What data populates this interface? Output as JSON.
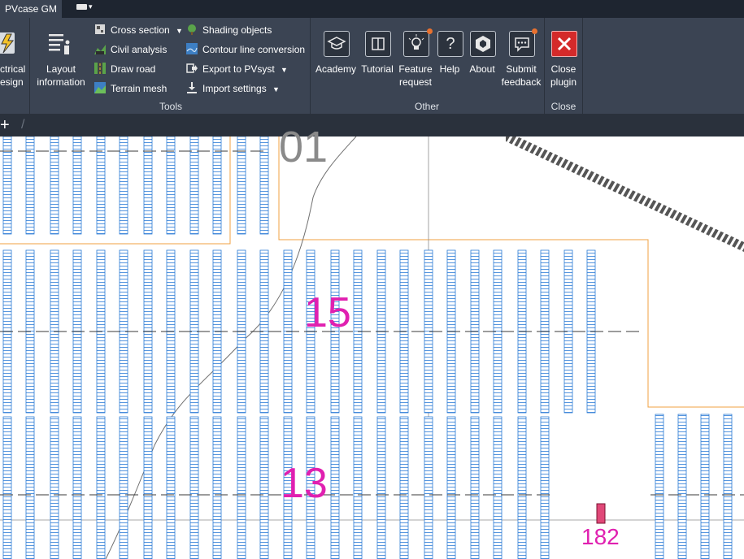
{
  "tabbar": {
    "active_tab": "PVcase GM"
  },
  "ribbon": {
    "electrical_design": {
      "line1": "ctrical",
      "line2": "esign"
    },
    "layout_information": {
      "line1": "Layout",
      "line2": "information"
    },
    "tools": {
      "group_label": "Tools",
      "column1": [
        "Cross section",
        "Civil analysis",
        "Draw road",
        "Terrain mesh"
      ],
      "column2": [
        "Shading objects",
        "Contour line conversion",
        "Export to PVsyst",
        "Import settings"
      ]
    },
    "other": {
      "group_label": "Other",
      "buttons": [
        {
          "line1": "Academy",
          "line2": ""
        },
        {
          "line1": "Tutorial",
          "line2": ""
        },
        {
          "line1": "Feature",
          "line2": "request"
        },
        {
          "line1": "Help",
          "line2": ""
        },
        {
          "line1": "About",
          "line2": ""
        },
        {
          "line1": "Submit",
          "line2": "feedback"
        }
      ]
    },
    "close": {
      "group_label": "Close",
      "line1": "Close",
      "line2": "plugin"
    }
  },
  "drawing": {
    "block_labels": [
      "15",
      "13",
      "01",
      "182"
    ],
    "colors": {
      "panel": "#2a7bd6",
      "boundary": "#f0a040",
      "label": "#e020b0",
      "road": "#555555"
    }
  }
}
